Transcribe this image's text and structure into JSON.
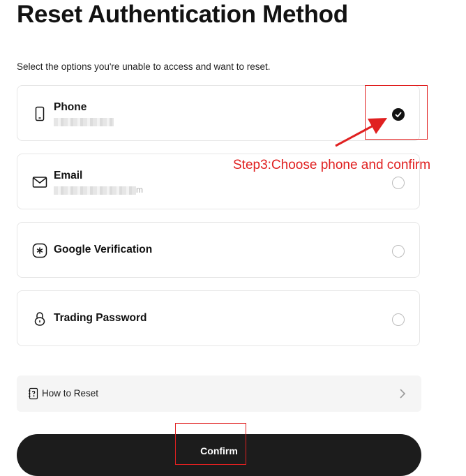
{
  "page": {
    "title": "Reset Authentication Method",
    "subtitle": "Select the options you're unable to access and want to reset."
  },
  "options": [
    {
      "label": "Phone",
      "icon": "phone-icon",
      "masked_value_suffix": "",
      "selected": true
    },
    {
      "label": "Email",
      "icon": "mail-icon",
      "masked_value_suffix": "m",
      "selected": false
    },
    {
      "label": "Google Verification",
      "icon": "authenticator-icon",
      "selected": false
    },
    {
      "label": "Trading Password",
      "icon": "lock-icon",
      "selected": false
    }
  ],
  "annotation": {
    "text": "Step3:Choose phone and confirm",
    "color": "#e02020"
  },
  "how_to_reset": {
    "label": "How to Reset",
    "icon": "help-book-icon",
    "chevron": "chevron-right-icon"
  },
  "confirm": {
    "label": "Confirm"
  }
}
